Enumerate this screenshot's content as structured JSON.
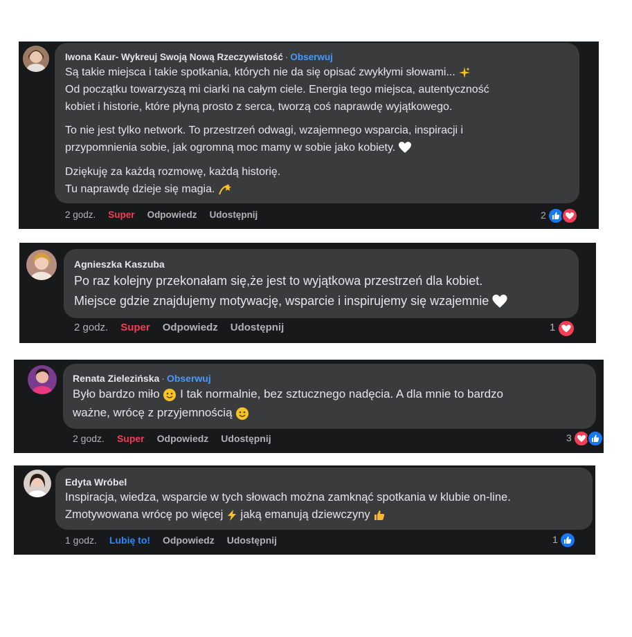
{
  "comments": [
    {
      "author": "Iwona Kaur- Wykreuj Swoją Nową Rzeczywistość",
      "follow": "Obserwuj",
      "lines": [
        "Są takie miejsca i takie spotkania, których nie da się opisać zwykłymi słowami...",
        "Od początku towarzyszą mi ciarki na całym ciele. Energia tego miejsca, autentyczność",
        "kobiet i historie, które płyną prosto z serca, tworzą coś naprawdę wyjątkowego.",
        "To nie jest tylko network. To przestrzeń odwagi, wzajemnego wsparcia, inspiracji i",
        "przypomnienia sobie, jak ogromną moc mamy w sobie jako kobiety.",
        "Dziękuję za każdą rozmowę, każdą historię.",
        "Tu naprawdę dzieje się magia."
      ],
      "time": "2 godz.",
      "reaction_label": "Super",
      "reply": "Odpowiedz",
      "share": "Udostępnij",
      "reaction_count": "2",
      "reaction_icons": [
        "like-icon",
        "love-icon"
      ]
    },
    {
      "author": "Agnieszka Kaszuba",
      "lines": [
        "Po raz kolejny przekonałam się,że jest to wyjątkowa przestrzeń dla kobiet.",
        "Miejsce gdzie znajdujemy motywację, wsparcie i inspirujemy się wzajemnie"
      ],
      "time": "2 godz.",
      "reaction_label": "Super",
      "reply": "Odpowiedz",
      "share": "Udostępnij",
      "reaction_count": "1",
      "reaction_icons": [
        "love-icon"
      ]
    },
    {
      "author": "Renata Zielezińska",
      "follow": "Obserwuj",
      "lines": [
        "Było bardzo miło",
        "I tak normalnie, bez sztucznego nadęcia. A dla mnie to bardzo",
        "ważne, wrócę z przyjemnością"
      ],
      "time": "2 godz.",
      "reaction_label": "Super",
      "reply": "Odpowiedz",
      "share": "Udostępnij",
      "reaction_count": "3",
      "reaction_icons": [
        "love-icon",
        "like-icon"
      ]
    },
    {
      "author": "Edyta Wróbel",
      "lines": [
        "Inspiracja, wiedza, wsparcie w tych słowach można zamknąć spotkania w klubie on-line.",
        "Zmotywowana wrócę po więcej",
        "jaką emanują dziewczyny"
      ],
      "time": "1 godz.",
      "reaction_label": "Lubię to!",
      "reply": "Odpowiedz",
      "share": "Udostępnij",
      "reaction_count": "1",
      "reaction_icons": [
        "like-icon"
      ]
    }
  ],
  "colors": {
    "panel": "#18191a",
    "bubble": "#3a3b3c",
    "text": "#e4e6eb",
    "muted": "#b0b3b8",
    "follow": "#4599ff",
    "super": "#f33e58",
    "like": "#2d88ff"
  }
}
